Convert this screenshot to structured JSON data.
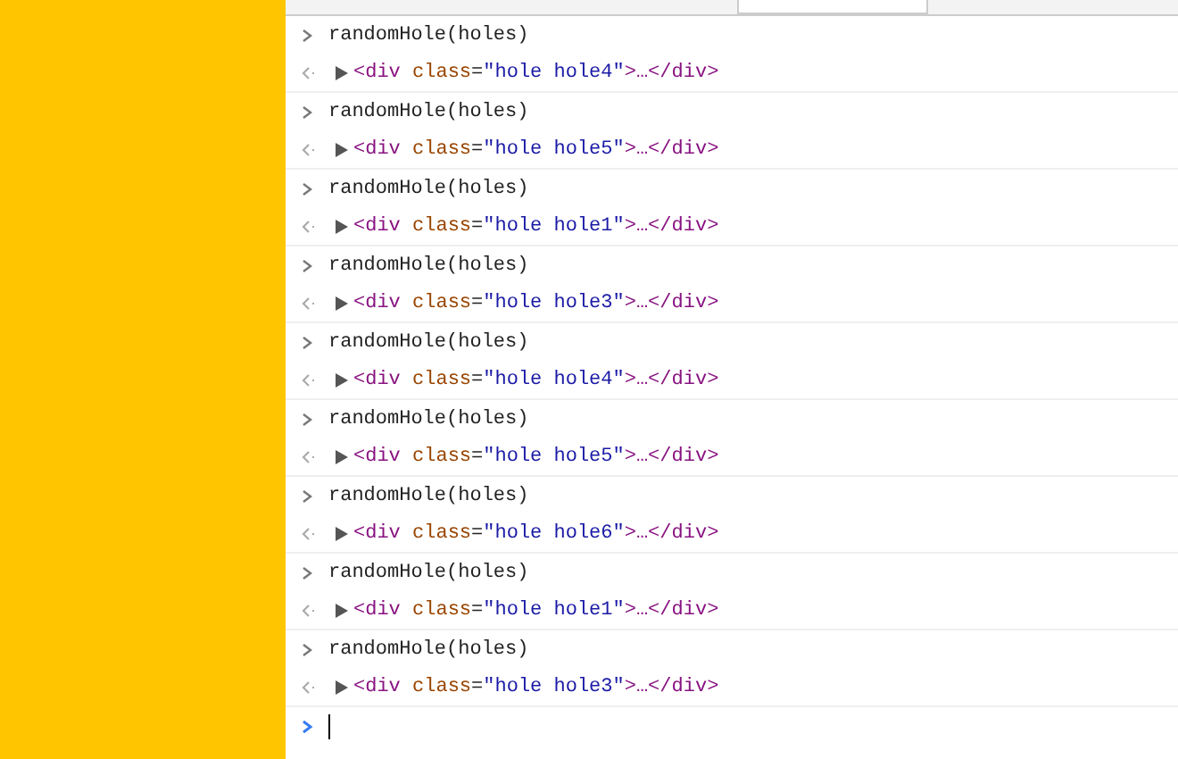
{
  "console": {
    "entries": [
      {
        "input": "randomHole(holes)",
        "output": {
          "expanded": false,
          "open": "<div",
          "attr": "class",
          "eq": "=",
          "value": "\"hole hole4\"",
          "close": ">…</div>"
        }
      },
      {
        "input": "randomHole(holes)",
        "output": {
          "expanded": false,
          "open": "<div",
          "attr": "class",
          "eq": "=",
          "value": "\"hole hole5\"",
          "close": ">…</div>"
        }
      },
      {
        "input": "randomHole(holes)",
        "output": {
          "expanded": false,
          "open": "<div",
          "attr": "class",
          "eq": "=",
          "value": "\"hole hole1\"",
          "close": ">…</div>"
        }
      },
      {
        "input": "randomHole(holes)",
        "output": {
          "expanded": false,
          "open": "<div",
          "attr": "class",
          "eq": "=",
          "value": "\"hole hole3\"",
          "close": ">…</div>"
        }
      },
      {
        "input": "randomHole(holes)",
        "output": {
          "expanded": false,
          "open": "<div",
          "attr": "class",
          "eq": "=",
          "value": "\"hole hole4\"",
          "close": ">…</div>"
        }
      },
      {
        "input": "randomHole(holes)",
        "output": {
          "expanded": false,
          "open": "<div",
          "attr": "class",
          "eq": "=",
          "value": "\"hole hole5\"",
          "close": ">…</div>"
        }
      },
      {
        "input": "randomHole(holes)",
        "output": {
          "expanded": false,
          "open": "<div",
          "attr": "class",
          "eq": "=",
          "value": "\"hole hole6\"",
          "close": ">…</div>"
        }
      },
      {
        "input": "randomHole(holes)",
        "output": {
          "expanded": false,
          "open": "<div",
          "attr": "class",
          "eq": "=",
          "value": "\"hole hole1\"",
          "close": ">…</div>"
        }
      },
      {
        "input": "randomHole(holes)",
        "output": {
          "expanded": false,
          "open": "<div",
          "attr": "class",
          "eq": "=",
          "value": "\"hole hole3\"",
          "close": ">…</div>"
        }
      }
    ]
  }
}
